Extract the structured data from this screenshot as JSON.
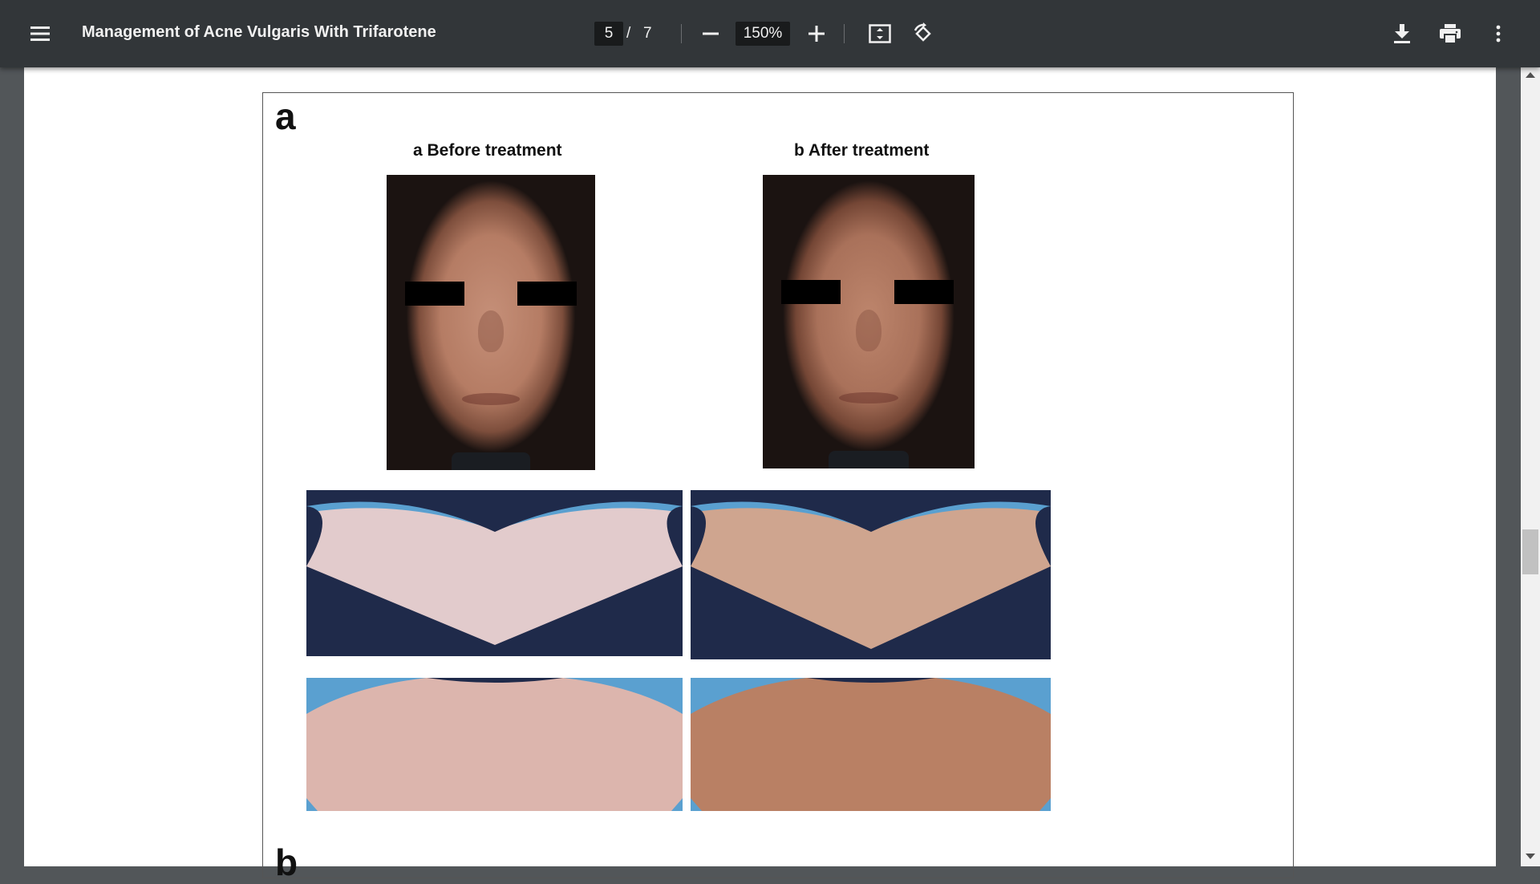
{
  "toolbar": {
    "title": "Management of Acne Vulgaris With Trifarotene",
    "current_page": "5",
    "page_separator": "/",
    "total_pages": "7",
    "zoom": "150%"
  },
  "figure": {
    "panel_a_label": "a",
    "panel_b_label": "b",
    "caption_before": "a Before treatment",
    "caption_after": "b After treatment"
  },
  "icons": {
    "menu": "menu-icon",
    "zoom_out": "minus-icon",
    "zoom_in": "plus-icon",
    "fit": "fit-to-page-icon",
    "rotate": "rotate-icon",
    "download": "download-icon",
    "print": "print-icon",
    "more": "more-vert-icon"
  },
  "colors": {
    "toolbar_bg": "#323639",
    "viewer_bg": "#525659",
    "shirt_navy": "#1f2a4a",
    "backdrop_blue": "#5aa0d0"
  }
}
